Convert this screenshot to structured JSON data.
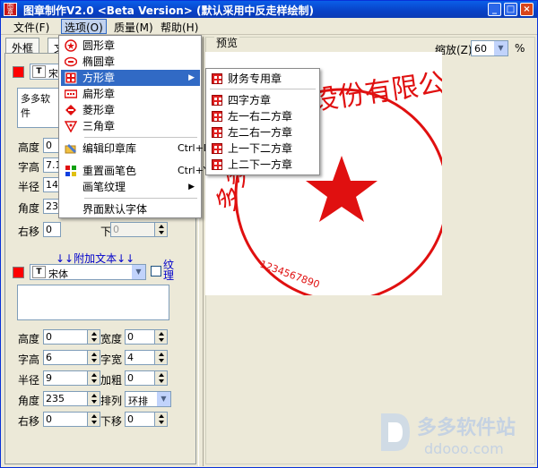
{
  "window": {
    "title": "图章制作V2.0 <Beta Version> (默认采用中反走样绘制)",
    "logo_text": "图章制作"
  },
  "menubar": {
    "items": [
      "文件(F)",
      "选项(O)",
      "质量(M)",
      "帮助(H)"
    ]
  },
  "tabs": [
    "外框",
    "文"
  ],
  "top_panel": {
    "font_combo": "宋体",
    "memo_text": "多多软件",
    "labels": [
      "高度",
      "字高",
      "半径",
      "角度",
      "右移"
    ],
    "values": [
      "0",
      "7.1",
      "14",
      "235",
      "0"
    ],
    "down_label": "下移",
    "down_value": "0"
  },
  "extra_text": {
    "header": "↓↓附加文本↓↓",
    "font": "宋体",
    "texture_label": "纹理",
    "fields": [
      {
        "label": "高度",
        "value": "0"
      },
      {
        "label": "宽度",
        "value": "0"
      },
      {
        "label": "字高",
        "value": "6"
      },
      {
        "label": "字宽",
        "value": "4"
      },
      {
        "label": "半径",
        "value": "9"
      },
      {
        "label": "加粗",
        "value": "0"
      },
      {
        "label": "角度",
        "value": "235"
      },
      {
        "label": "排列",
        "value": "环排"
      },
      {
        "label": "右移",
        "value": "0"
      },
      {
        "label": "下移",
        "value": "0"
      }
    ]
  },
  "preview": {
    "label": "预览",
    "zoom_label": "缩放(Z)",
    "zoom_value": "60",
    "zoom_unit": "%"
  },
  "stamp": {
    "top_text": "设份有限公司",
    "left_text": "多多",
    "digits": "1234567890",
    "color": "#e01010"
  },
  "options_menu": {
    "items": [
      {
        "label": "圆形章",
        "icon": "circle-stamp-icon"
      },
      {
        "label": "椭圆章",
        "icon": "ellipse-stamp-icon"
      },
      {
        "label": "方形章",
        "icon": "square-stamp-icon",
        "submenu": true
      },
      {
        "label": "扁形章",
        "icon": "flat-stamp-icon"
      },
      {
        "label": "菱形章",
        "icon": "diamond-stamp-icon"
      },
      {
        "label": "三角章",
        "icon": "triangle-stamp-icon"
      },
      {
        "label": "编辑印章库",
        "shortcut": "Ctrl+D",
        "icon": "edit-library-icon"
      },
      {
        "label": "重置画笔色",
        "shortcut": "Ctrl+Y",
        "icon": "palette-icon"
      },
      {
        "label": "画笔纹理",
        "submenu": true
      },
      {
        "label": "界面默认字体"
      }
    ]
  },
  "square_submenu": {
    "items": [
      "财务专用章",
      "四字方章",
      "左一右二方章",
      "左二右一方章",
      "上一下二方章",
      "上二下一方章"
    ]
  },
  "watermark": {
    "text": "多多软件站",
    "url": "ddooo.com"
  },
  "colors": {
    "accent": "#316ac5",
    "stamp_red": "#e01010",
    "title_blue": "#0841c6"
  }
}
